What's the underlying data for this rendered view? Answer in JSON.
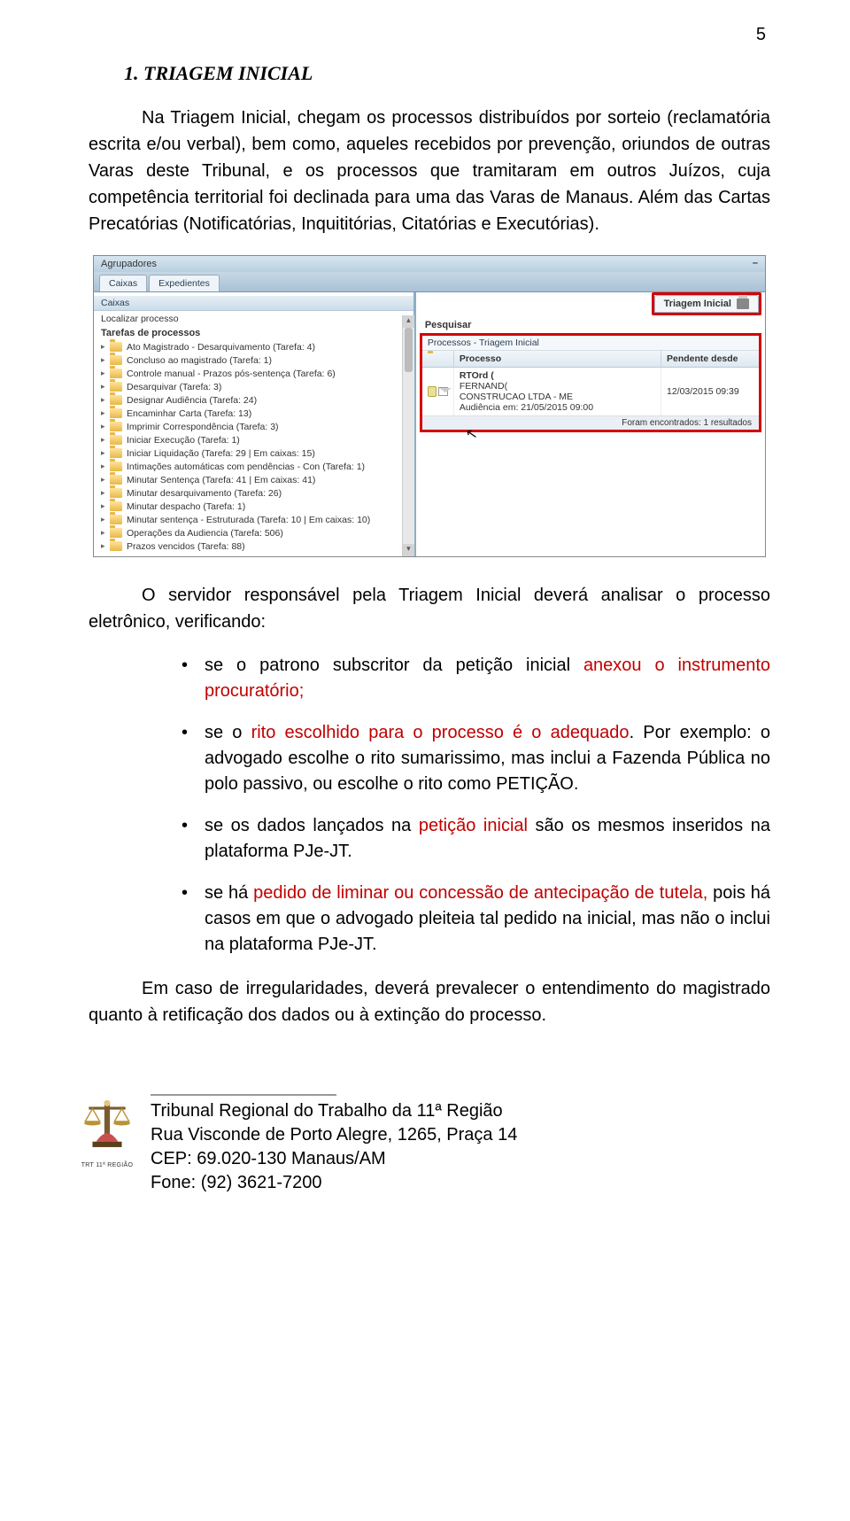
{
  "page_number": "5",
  "heading": "1. TRIAGEM INICIAL",
  "para1": "Na Triagem Inicial, chegam os processos distribuídos por sorteio (reclamatória escrita e/ou verbal), bem como, aqueles recebidos por prevenção, oriundos de outras Varas deste Tribunal, e os processos que tramitaram em outros Juízos, cuja competência territorial foi declinada para uma das Varas de Manaus. Além das Cartas Precatórias (Notificatórias, Inquititórias, Citatórias e Executórias).",
  "para2": "O servidor responsável pela Triagem Inicial deverá analisar o processo eletrônico, verificando:",
  "bullet1_pre": "se o patrono subscritor da petição inicial ",
  "bullet1_red": "anexou o instrumento procuratório;",
  "bullet2_pre": "se o ",
  "bullet2_red": "rito escolhido para o processo é o adequado",
  "bullet2_post": ". Por exemplo: o advogado escolhe o rito sumarissimo, mas inclui a Fazenda Pública no polo passivo, ou escolhe o rito como PETIÇÃO.",
  "bullet3_pre": "se os dados lançados na ",
  "bullet3_red": "petição inicial",
  "bullet3_post": " são os mesmos inseridos na plataforma PJe-JT.",
  "bullet4_pre": "se há ",
  "bullet4_red": "pedido de liminar ou concessão de antecipação de tutela,",
  "bullet4_post": " pois há casos em que o advogado pleiteia tal pedido na inicial, mas não o inclui na plataforma PJe-JT.",
  "para3": "Em caso de irregularidades, deverá prevalecer o entendimento do magistrado quanto à retificação dos dados ou à extinção do processo.",
  "footer": {
    "line1": "Tribunal Regional do Trabalho da 11ª Região",
    "line2": "Rua Visconde de Porto Alegre, 1265, Praça 14",
    "line3": "CEP: 69.020-130 Manaus/AM",
    "line4": "Fone: (92) 3621-7200",
    "logo_caption": "TRT 11ª REGIÃO"
  },
  "screenshot": {
    "agrupadores": "Agrupadores",
    "tab_caixas": "Caixas",
    "tab_expedientes": "Expedientes",
    "left_tab": "Caixas",
    "localizar": "Localizar processo",
    "tarefas_header": "Tarefas de processos",
    "tasks": [
      "Ato Magistrado - Desarquivamento   (Tarefa: 4)",
      "Concluso ao magistrado   (Tarefa: 1)",
      "Controle manual - Prazos pós-sentença   (Tarefa: 6)",
      "Desarquivar   (Tarefa: 3)",
      "Designar Audiência   (Tarefa: 24)",
      "Encaminhar Carta   (Tarefa: 13)",
      "Imprimir Correspondência   (Tarefa: 3)",
      "Iniciar Execução   (Tarefa: 1)",
      "Iniciar Liquidação   (Tarefa: 29 | Em caixas: 15)",
      "Intimações automáticas com pendências - Con   (Tarefa: 1)",
      "Minutar Sentença   (Tarefa: 41 | Em caixas: 41)",
      "Minutar desarquivamento   (Tarefa: 26)",
      "Minutar despacho   (Tarefa: 1)",
      "Minutar sentença - Estruturada   (Tarefa: 10 | Em caixas: 10)",
      "Operações da Audiencia   (Tarefa: 506)",
      "Prazos vencidos   (Tarefa: 88)"
    ],
    "right_tab": "Triagem Inicial",
    "pesquisar": "Pesquisar",
    "breadcrumb": "Processos - Triagem Inicial",
    "col_processo": "Processo",
    "col_pendente": "Pendente desde",
    "row": {
      "line1_bold": "RTOrd (",
      "line2": "FERNAND(",
      "line3": "CONSTRUCAO LTDA - ME",
      "line4": "Audiência em: 21/05/2015 09:00",
      "pendente": "12/03/2015 09:39"
    },
    "resultados": "Foram encontrados: 1 resultados"
  }
}
